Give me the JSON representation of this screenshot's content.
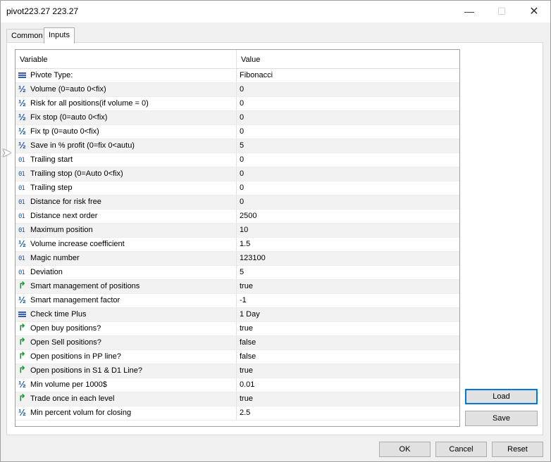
{
  "window": {
    "title": "pivot223.27 223.27",
    "min_icon": "minimize-icon",
    "max_icon": "maximize-icon",
    "close_icon": "close-icon"
  },
  "tabs": [
    {
      "label": "Common"
    },
    {
      "label": "Inputs"
    }
  ],
  "table": {
    "headers": {
      "variable": "Variable",
      "value": "Value"
    },
    "rows": [
      {
        "type": "enum",
        "name": "Pivote Type:",
        "value": "Fibonacci"
      },
      {
        "type": "double",
        "name": "Volume (0=auto 0<fix)",
        "value": "0"
      },
      {
        "type": "double",
        "name": "Risk for all positions(if volume = 0)",
        "value": "0"
      },
      {
        "type": "double",
        "name": "Fix stop (0=auto 0<fix)",
        "value": "0"
      },
      {
        "type": "double",
        "name": "Fix tp (0=auto 0<fix)",
        "value": "0"
      },
      {
        "type": "double",
        "name": "Save in % profit (0=fix 0<autu)",
        "value": "5"
      },
      {
        "type": "int",
        "name": "Trailing start",
        "value": "0"
      },
      {
        "type": "int",
        "name": "Trailing stop (0=Auto 0<fix)",
        "value": "0"
      },
      {
        "type": "int",
        "name": "Trailing step",
        "value": "0"
      },
      {
        "type": "int",
        "name": "Distance for risk free",
        "value": "0"
      },
      {
        "type": "int",
        "name": "Distance next order",
        "value": "2500"
      },
      {
        "type": "int",
        "name": "Maximum position",
        "value": "10"
      },
      {
        "type": "double",
        "name": "Volume increase coefficient",
        "value": "1.5"
      },
      {
        "type": "int",
        "name": "Magic number",
        "value": "123100"
      },
      {
        "type": "int",
        "name": "Deviation",
        "value": "5"
      },
      {
        "type": "bool",
        "name": "Smart management of positions",
        "value": "true"
      },
      {
        "type": "double",
        "name": "Smart management factor",
        "value": "-1"
      },
      {
        "type": "enum",
        "name": "Check time Plus",
        "value": "1 Day"
      },
      {
        "type": "bool",
        "name": "Open buy positions?",
        "value": "true"
      },
      {
        "type": "bool",
        "name": "Open Sell positions?",
        "value": "false"
      },
      {
        "type": "bool",
        "name": "Open positions in PP line?",
        "value": "false"
      },
      {
        "type": "bool",
        "name": "Open positions in S1 & D1 Line?",
        "value": "true"
      },
      {
        "type": "double",
        "name": "Min volume per 1000$",
        "value": "0.01"
      },
      {
        "type": "bool",
        "name": "Trade once in each level",
        "value": "true"
      },
      {
        "type": "double",
        "name": "Min percent volum for closing",
        "value": "2.5"
      }
    ]
  },
  "buttons": {
    "load": "Load",
    "save": "Save",
    "ok": "OK",
    "cancel": "Cancel",
    "reset": "Reset"
  },
  "icons": {
    "double": "fraction-icon",
    "int": "integer-icon",
    "bool": "boolean-icon",
    "enum": "enum-list-icon"
  },
  "colors": {
    "accent": "#0078d7",
    "alt_row": "#f2f2f2"
  }
}
